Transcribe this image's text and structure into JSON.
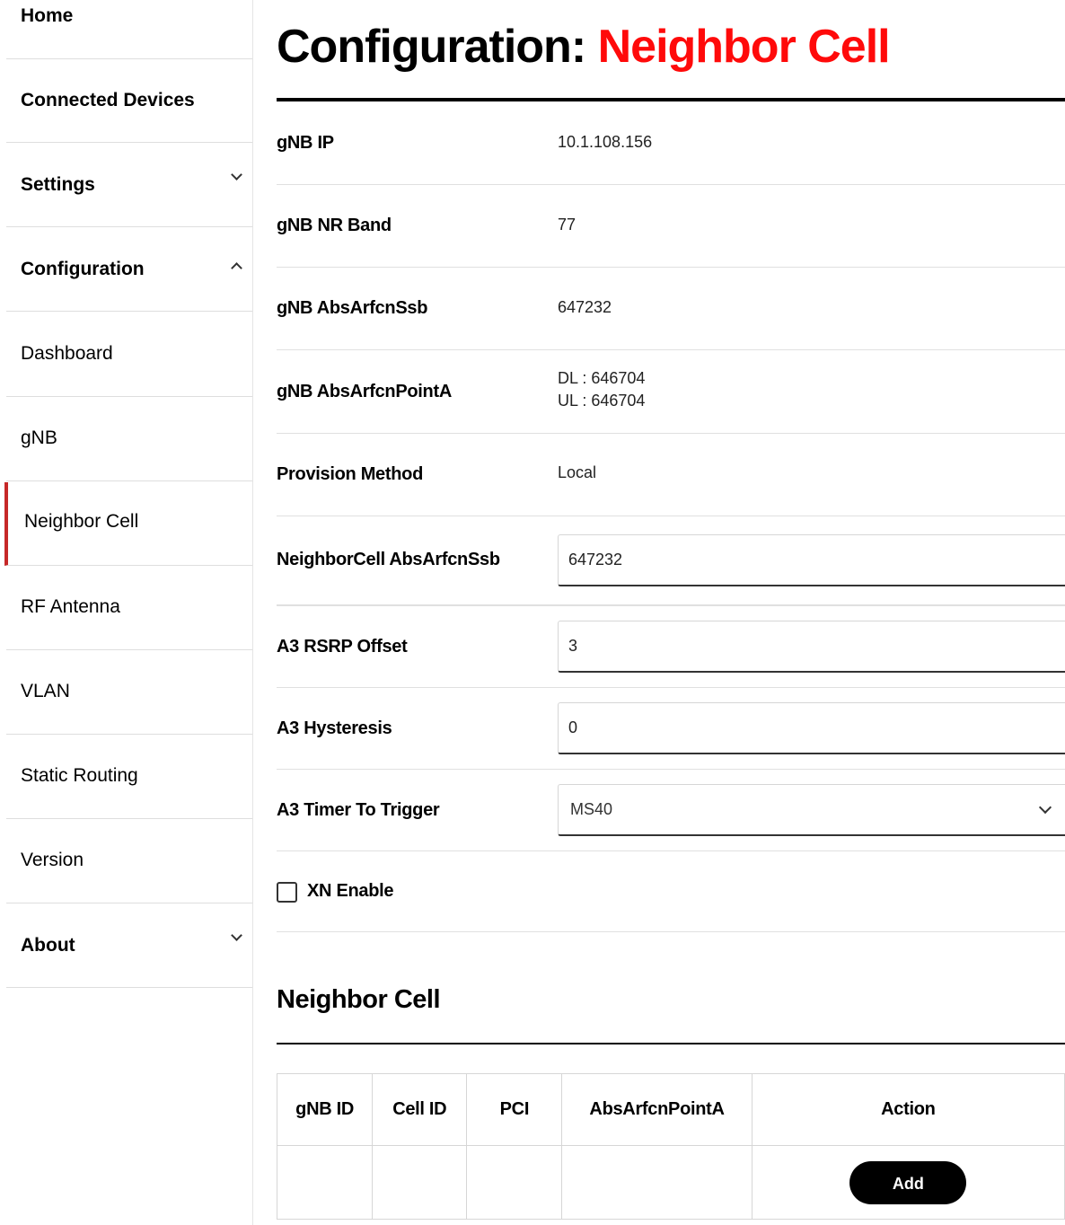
{
  "sidebar": {
    "items": [
      {
        "label": "Home"
      },
      {
        "label": "Connected Devices"
      },
      {
        "label": "Settings"
      },
      {
        "label": "Configuration"
      },
      {
        "label": "Dashboard"
      },
      {
        "label": "gNB"
      },
      {
        "label": "Neighbor Cell"
      },
      {
        "label": "RF Antenna"
      },
      {
        "label": "VLAN"
      },
      {
        "label": "Static Routing"
      },
      {
        "label": "Version"
      },
      {
        "label": "About"
      }
    ],
    "active_item": "Neighbor Cell",
    "active_color": "#c62828"
  },
  "page": {
    "title_prefix": "Configuration:",
    "title_accent": "Neighbor Cell",
    "accent_color": "#ff0a0a"
  },
  "info": {
    "gnb_ip": {
      "label": "gNB IP",
      "value": "10.1.108.156"
    },
    "gnb_nr_band": {
      "label": "gNB NR Band",
      "value": "77"
    },
    "gnb_absarfcnssb": {
      "label": "gNB AbsArfcnSsb",
      "value": "647232"
    },
    "gnb_absarfcnpointa": {
      "label": "gNB AbsArfcnPointA",
      "dl": "DL : 646704",
      "ul": "UL : 646704"
    },
    "provision_method": {
      "label": "Provision Method",
      "value": "Local"
    }
  },
  "form": {
    "neighborcell_absarfcnssb": {
      "label": "NeighborCell AbsArfcnSsb",
      "value": "647232"
    },
    "a3_rsrp_offset": {
      "label": "A3 RSRP Offset",
      "value": "3"
    },
    "a3_hysteresis": {
      "label": "A3 Hysteresis",
      "value": "0"
    },
    "a3_timer_to_trigger": {
      "label": "A3 Timer To Trigger",
      "value": "MS40"
    },
    "xn_enable": {
      "label": "XN Enable",
      "checked": false
    }
  },
  "neighbor_table": {
    "title": "Neighbor Cell",
    "columns": [
      "gNB ID",
      "Cell ID",
      "PCI",
      "AbsArfcnPointA",
      "Action"
    ],
    "add_label": "Add"
  }
}
